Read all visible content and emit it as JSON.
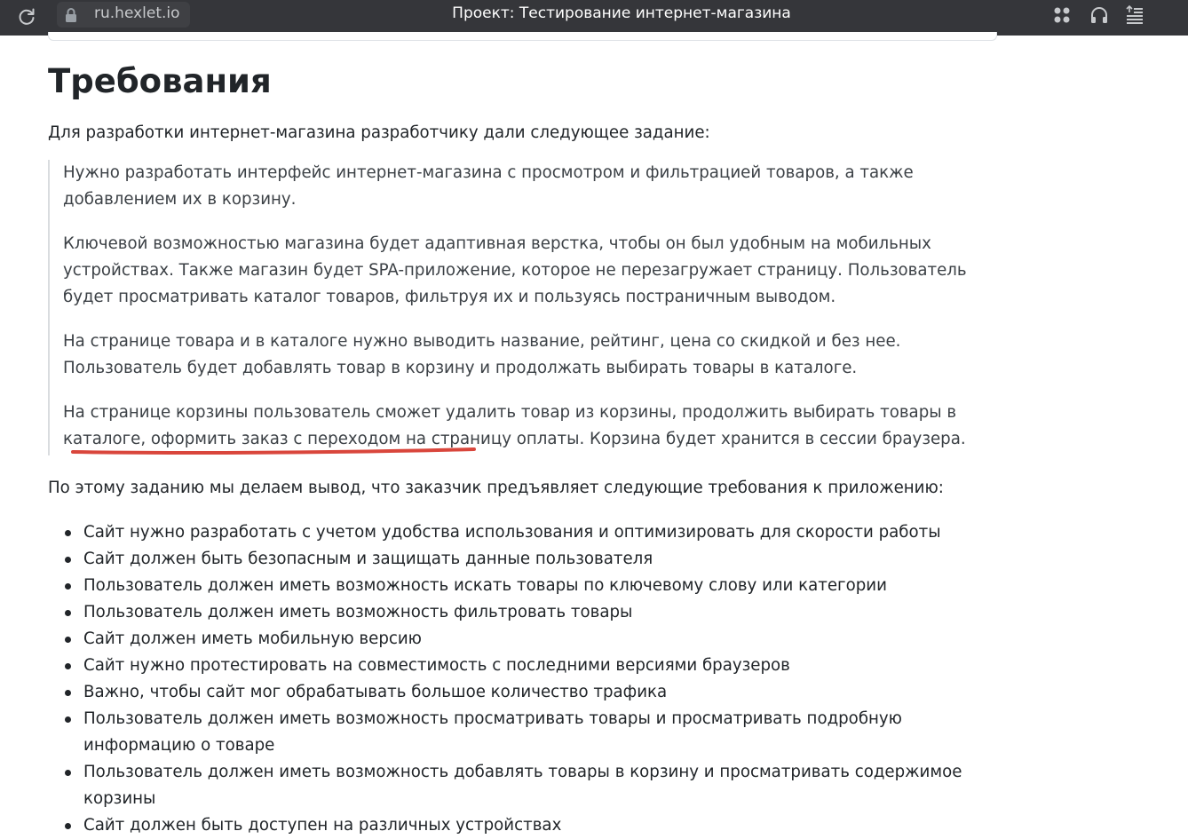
{
  "browser": {
    "url": "ru.hexlet.io",
    "tab_title": "Проект: Тестирование интернет-магазина",
    "icons": [
      "reload-icon",
      "lock-icon",
      "extensions-icon",
      "headphones-icon",
      "reader-mode-icon"
    ]
  },
  "article": {
    "heading": "Требования",
    "intro": "Для разработки интернет-магазина разработчику дали следующее задание:",
    "quote": [
      "Нужно разработать интерфейс интернет-магазина с просмотром и фильтрацией товаров, а также добавлением их в корзину.",
      "Ключевой возможностью магазина будет адаптивная верстка, чтобы он был удобным на мобильных устройствах. Также магазин будет SPA-приложение, которое не перезагружает страницу. Пользователь будет просматривать каталог товаров, фильтруя их и пользуясь постраничным выводом.",
      "На странице товара и в каталоге нужно выводить название, рейтинг, цена со скидкой и без нее. Пользователь будет добавлять товар в корзину и продолжать выбирать товары в каталоге.",
      "На странице корзины пользователь сможет удалить товар из корзины, продолжить выбирать товары в каталоге, оформить заказ с переходом на страницу оплаты. Корзина будет хранится в сессии браузера."
    ],
    "summary": "По этому заданию мы делаем вывод, что заказчик предъявляет следующие требования к приложению:",
    "requirements": [
      "Сайт нужно разработать с учетом удобства использования и оптимизировать для скорости работы",
      "Сайт должен быть безопасным и защищать данные пользователя",
      "Пользователь должен иметь возможность искать товары по ключевому слову или категории",
      "Пользователь должен иметь возможность фильтровать товары",
      "Сайт должен иметь мобильную версию",
      "Сайт нужно протестировать на совместимость с последними версиями браузеров",
      "Важно, чтобы сайт мог обрабатывать большое количество трафика",
      "Пользователь должен иметь возможность просматривать товары и просматривать подробную информацию о товаре",
      "Пользователь должен иметь возможность добавлять товары в корзину и просматривать содержимое корзины",
      "Сайт должен быть доступен на различных устройствах"
    ],
    "annotation_color": "#d9463c"
  }
}
